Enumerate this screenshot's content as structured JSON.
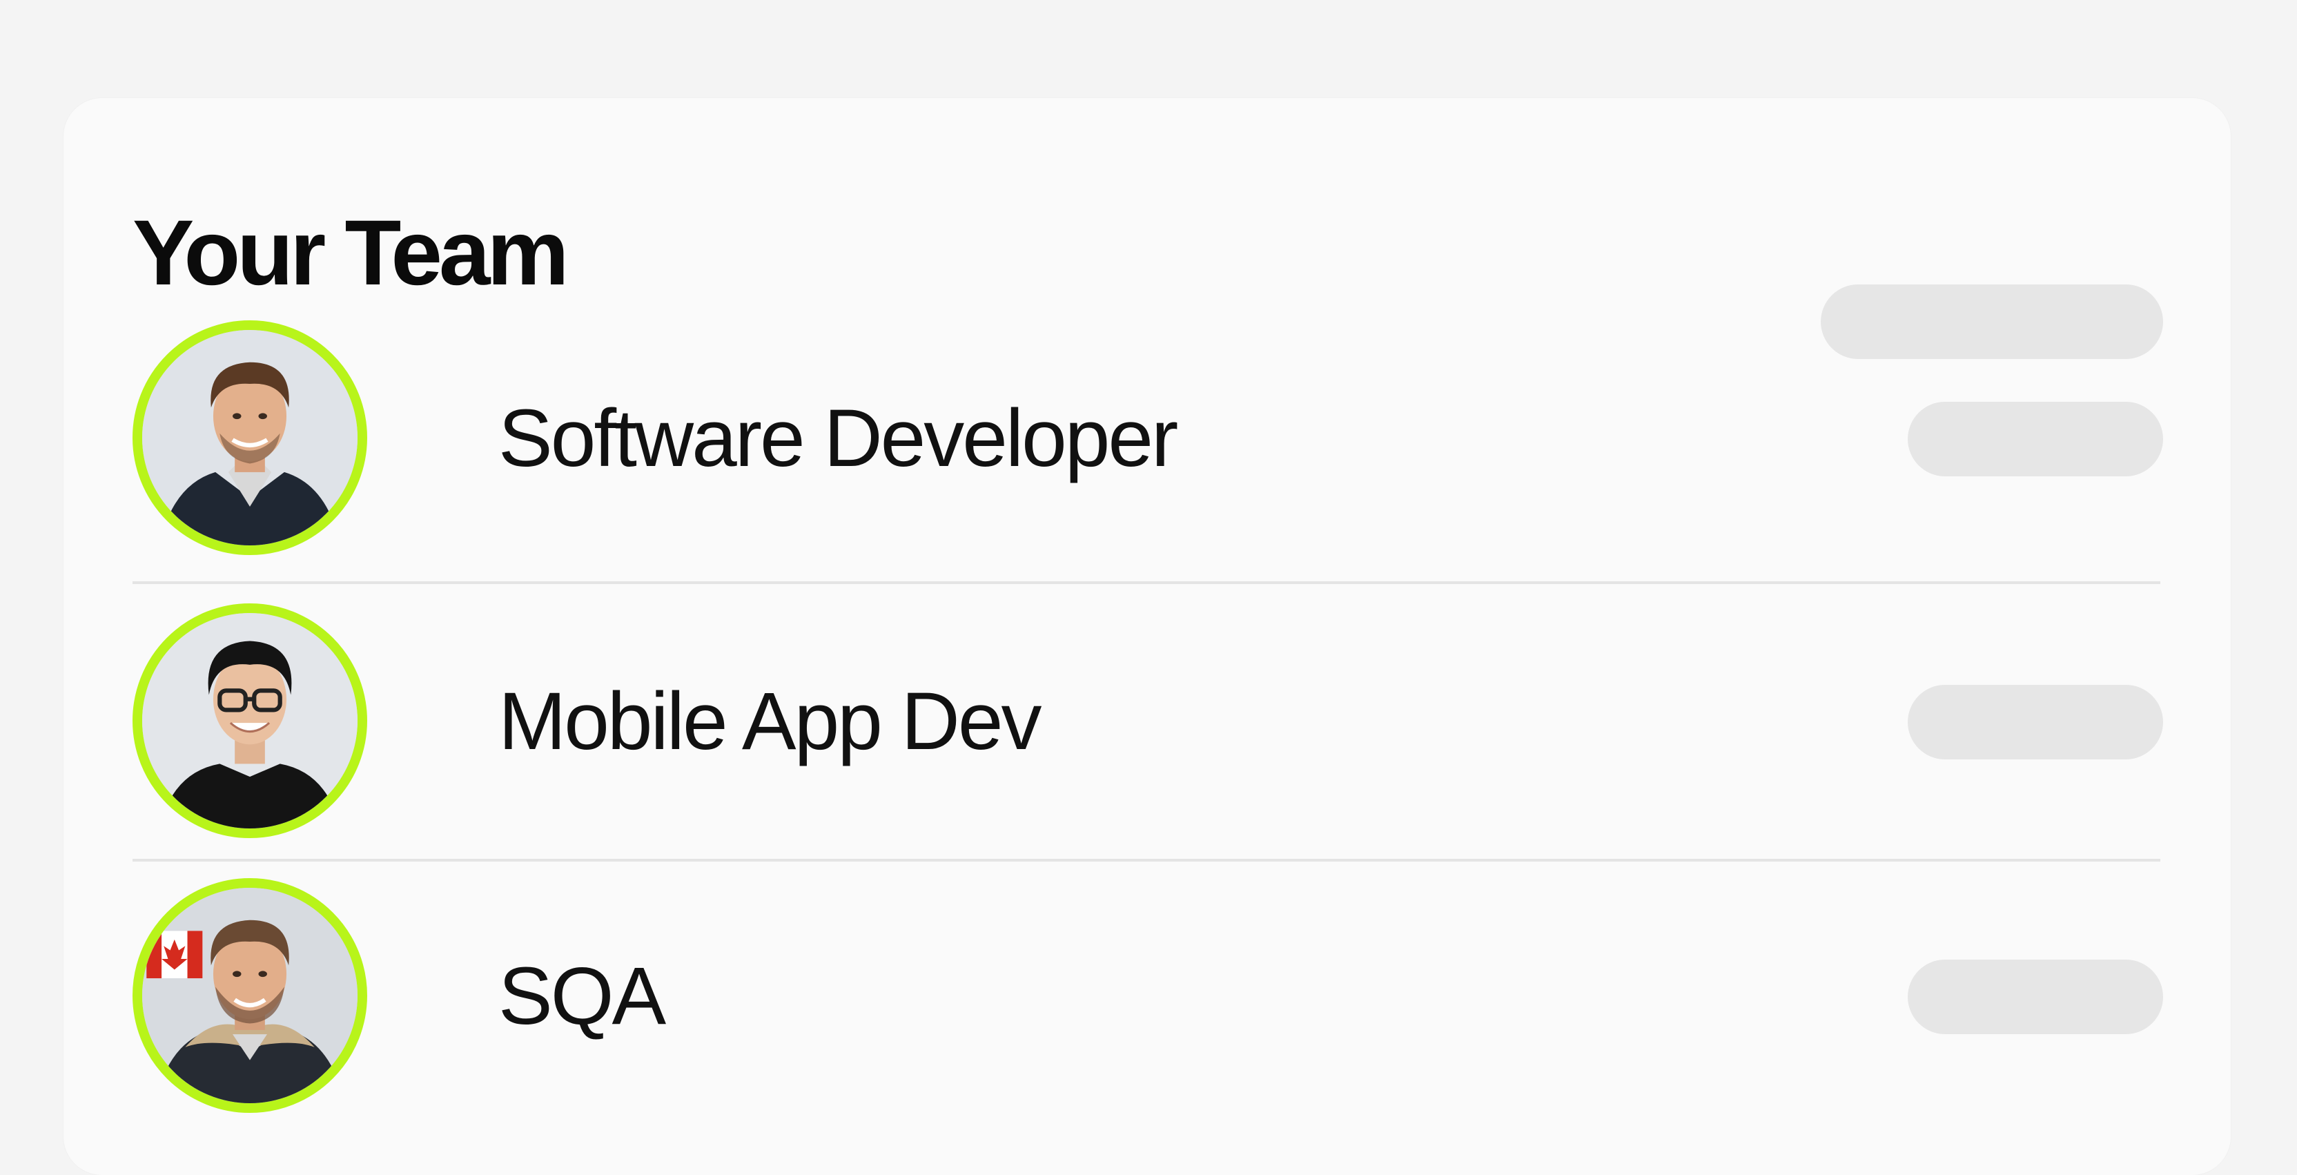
{
  "team": {
    "title": "Your Team",
    "members": [
      {
        "role": "Software Developer",
        "avatar": "avatar-man-dark-hoodie"
      },
      {
        "role": "Mobile App Dev",
        "avatar": "avatar-man-glasses"
      },
      {
        "role": "SQA",
        "avatar": "avatar-man-canada-flag"
      }
    ]
  },
  "colors": {
    "accent_ring": "#b8f41a",
    "placeholder_pill": "#e6e6e6",
    "card_bg": "#fafafa",
    "text": "#111111"
  }
}
